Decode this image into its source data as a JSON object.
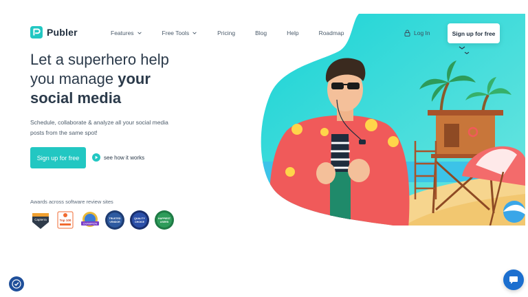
{
  "brand": {
    "name": "Publer",
    "color": "#22c7c2"
  },
  "nav": {
    "items": [
      {
        "label": "Features",
        "dropdown": true
      },
      {
        "label": "Free Tools",
        "dropdown": true
      },
      {
        "label": "Pricing",
        "dropdown": false
      },
      {
        "label": "Blog",
        "dropdown": false
      },
      {
        "label": "Help",
        "dropdown": false
      },
      {
        "label": "Roadmap",
        "dropdown": false
      }
    ],
    "login_label": "Log In",
    "signup_label": "Sign up for free"
  },
  "hero": {
    "title_line1": "Let a superhero help",
    "title_line2_normal": "you manage ",
    "title_line2_bold": "your",
    "title_line3_bold": "social media",
    "subtitle": "Schedule, collaborate & analyze all your social media posts from the same spot!",
    "cta_label": "Sign up for free",
    "how_label": "see how it works"
  },
  "awards": {
    "label": "Awards across software review sites",
    "badges": [
      {
        "name": "capterra-shortlist-badge",
        "text": "Capterra",
        "color": "#f0a030"
      },
      {
        "name": "top100-badge",
        "text": "Top 100",
        "color": "#ffffff"
      },
      {
        "name": "champion-badge",
        "text": "CHAMPION",
        "color": "#3a7bd5"
      },
      {
        "name": "trusted-vendor-badge",
        "text": "TRUSTED VENDOR",
        "color": "#2d5aa0"
      },
      {
        "name": "quality-choice-badge",
        "text": "QUALITY CHOICE",
        "color": "#2b4fa8"
      },
      {
        "name": "happiest-users-badge",
        "text": "HAPPIEST USERS",
        "color": "#2e9c5a"
      }
    ]
  },
  "colors": {
    "accent": "#22c7c2",
    "text": "#2b3a4a",
    "chat": "#1c6fcf"
  }
}
